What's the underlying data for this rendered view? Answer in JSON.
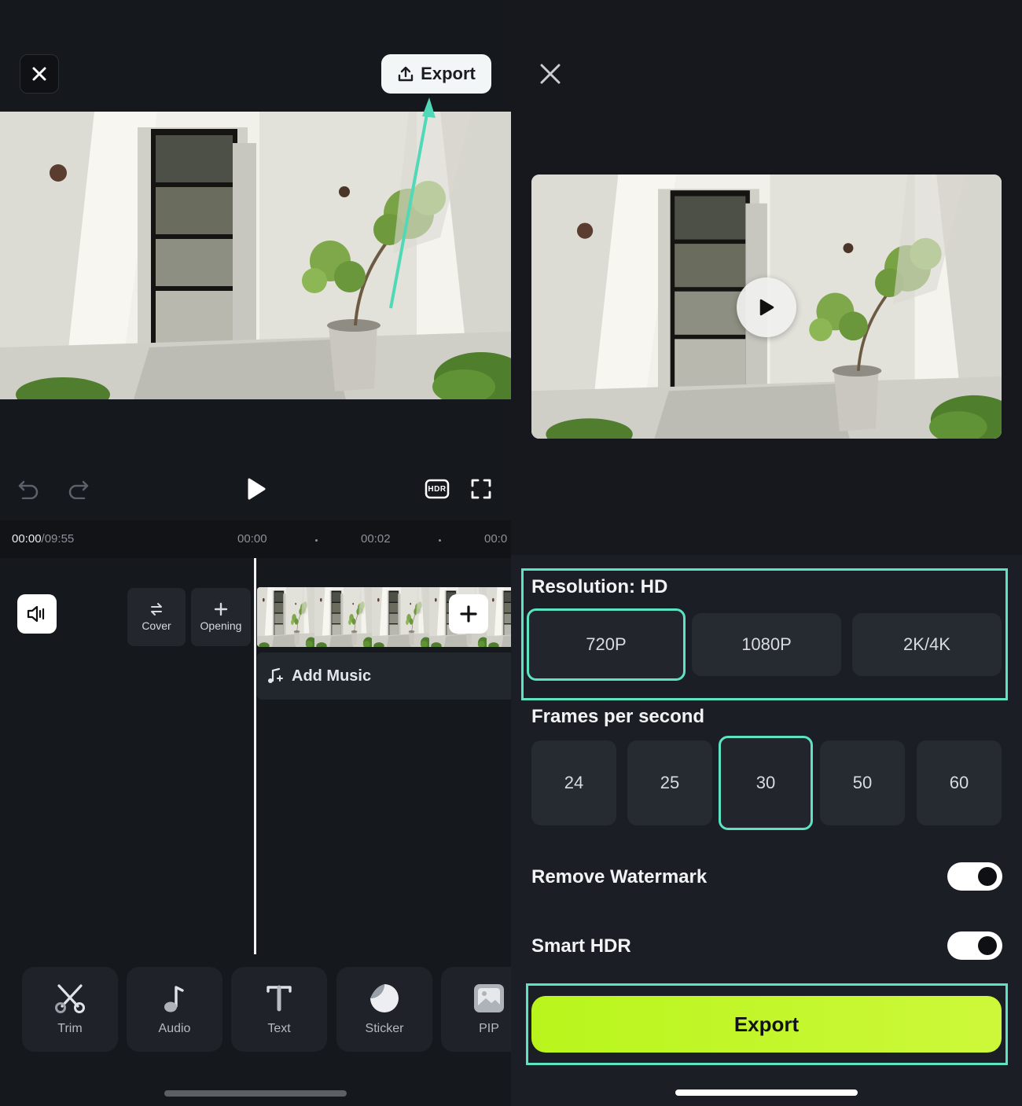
{
  "left": {
    "close_icon": "close-icon",
    "export_button": {
      "label": "Export",
      "icon": "upload-icon"
    },
    "player": {
      "undo_icon": "undo-icon",
      "redo_icon": "redo-icon",
      "play_icon": "play-icon",
      "hdr_label": "HDR",
      "fullscreen_icon": "fullscreen-icon"
    },
    "timeline": {
      "current_time": "00:00",
      "total_time": "/09:55",
      "ruler": [
        "00:00",
        "00:02",
        "00:0"
      ],
      "mute_icon": "speaker-icon",
      "cover_label": "Cover",
      "opening_label": "Opening",
      "add_clip_icon": "plus-icon",
      "add_music_label": "Add Music"
    },
    "tools": [
      {
        "label": "Trim",
        "icon": "scissors-icon"
      },
      {
        "label": "Audio",
        "icon": "music-note-icon"
      },
      {
        "label": "Text",
        "icon": "text-icon"
      },
      {
        "label": "Sticker",
        "icon": "sticker-icon"
      },
      {
        "label": "PIP",
        "icon": "pip-icon"
      }
    ]
  },
  "right": {
    "close_icon": "close-icon",
    "preview_play_icon": "play-icon",
    "resolution": {
      "label": "Resolution: HD",
      "options": [
        "720P",
        "1080P",
        "2K/4K"
      ],
      "selected": "720P"
    },
    "fps": {
      "label": "Frames per second",
      "options": [
        "24",
        "25",
        "30",
        "50",
        "60"
      ],
      "selected": "30"
    },
    "remove_watermark": {
      "label": "Remove Watermark",
      "on": true
    },
    "smart_hdr": {
      "label": "Smart HDR",
      "on": true
    },
    "export_label": "Export"
  },
  "colors": {
    "accent_highlight": "#5ee3c2",
    "export_green": "#c2f52a",
    "background": "#15181d"
  }
}
